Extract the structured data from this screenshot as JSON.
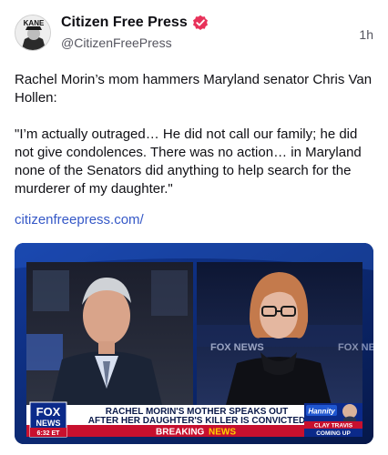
{
  "post": {
    "author": {
      "display_name": "Citizen Free Press",
      "handle": "@CitizenFreePress",
      "avatar_text": "KANE",
      "verified_badge_color": "#e8325a"
    },
    "timestamp": "1h",
    "text_paragraphs": [
      "Rachel Morin’s mom hammers Maryland senator Chris Van Hollen:",
      "\"I’m actually outraged… He did not call our family; he did not give condolences. There was no action… in Maryland none of the Senators did anything to help search for the murderer of my daughter.\""
    ],
    "link_text": "citizenfreepress.com/",
    "link_color": "#3558c7"
  },
  "media": {
    "type": "video-still",
    "network_logo_lines": [
      "FOX",
      "NEWS"
    ],
    "clock": "6:32 ET",
    "chyron_line1": "RACHEL MORIN'S MOTHER SPEAKS OUT",
    "chyron_line2": "AFTER HER DAUGHTER'S KILLER IS CONVICTED",
    "ticker_label": "BREAKING",
    "ticker_highlight": "NEWS",
    "right_box_show": "Hannity",
    "right_box_guest": "CLAY TRAVIS",
    "right_box_tag": "COMING UP",
    "studio_watermark": "FOX NEWS",
    "colors": {
      "brand_blue": "#0b2a8a",
      "breaking_red": "#c8102e",
      "highlight_yellow": "#ffd200"
    }
  }
}
